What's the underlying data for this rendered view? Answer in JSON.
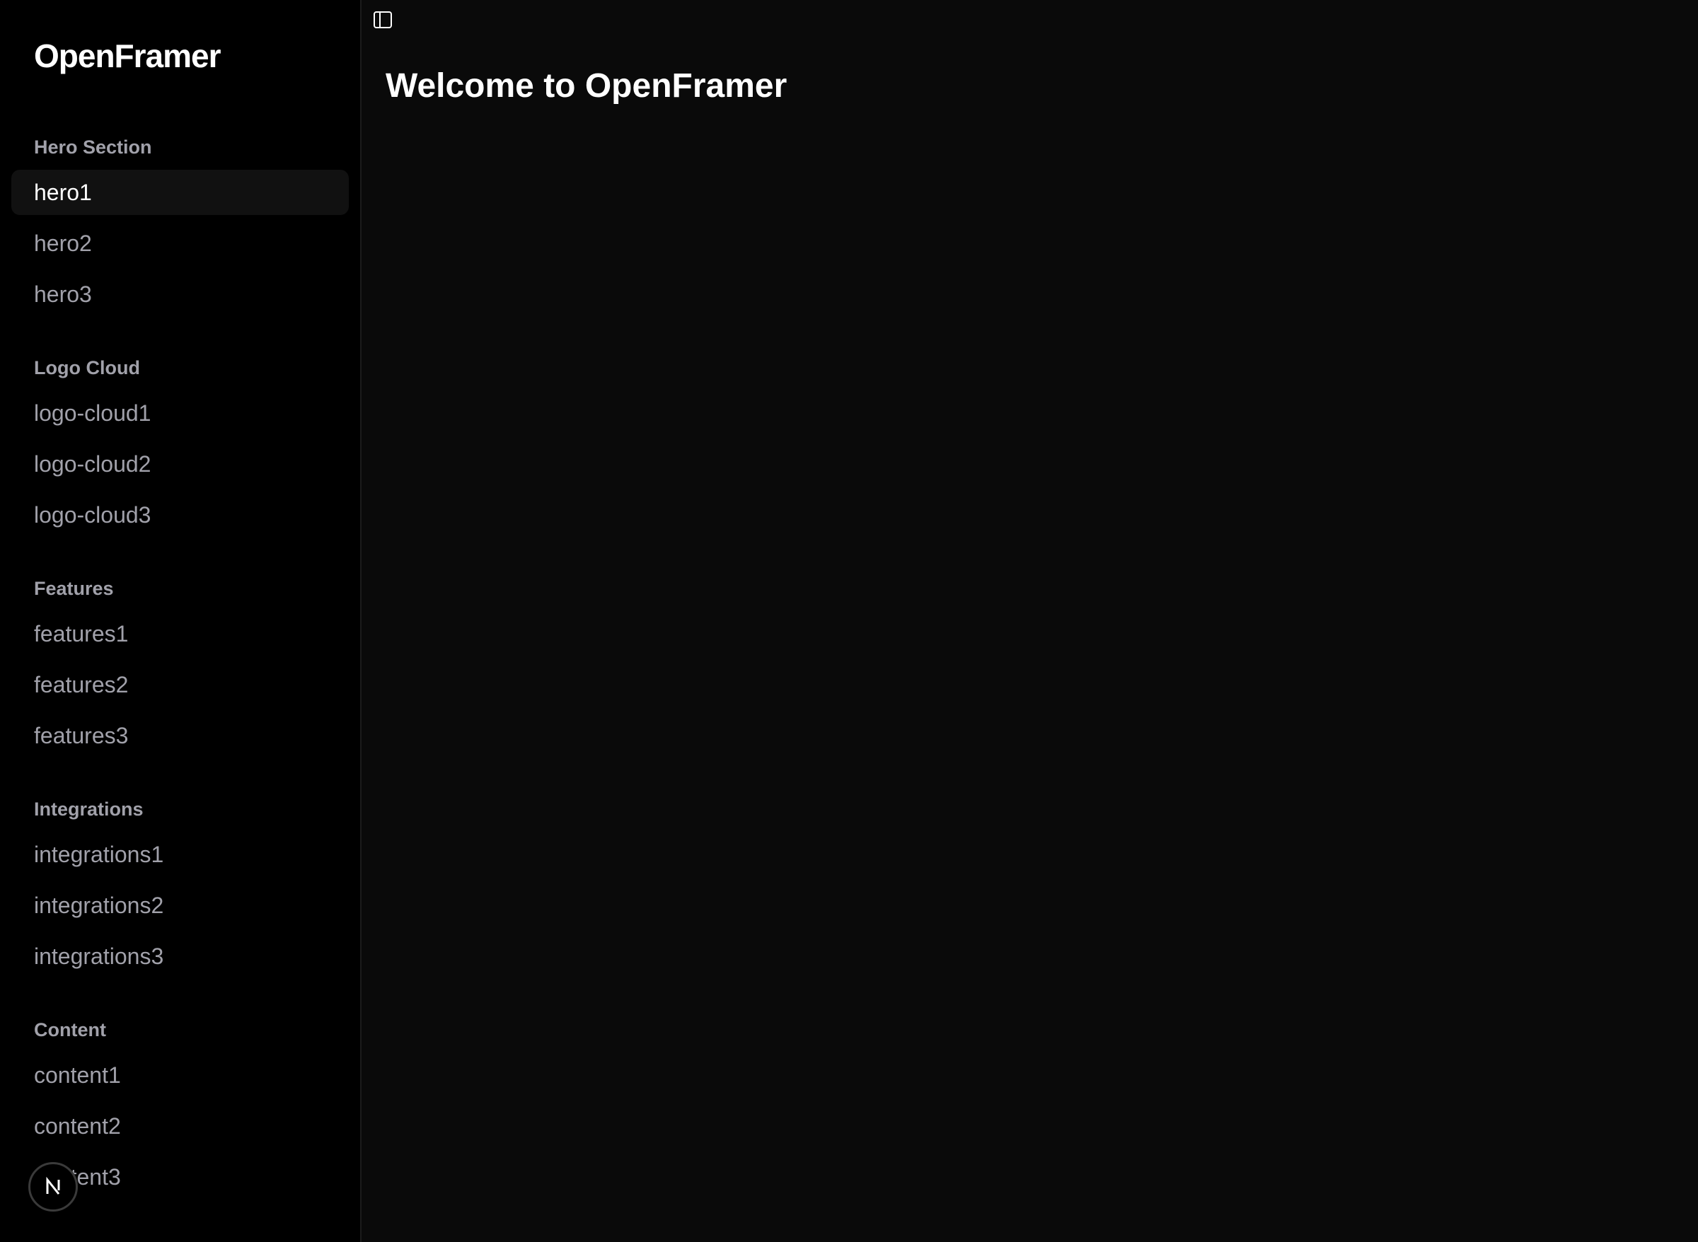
{
  "sidebar": {
    "logo": "OpenFramer",
    "groups": [
      {
        "title": "Hero Section",
        "items": [
          "hero1",
          "hero2",
          "hero3"
        ]
      },
      {
        "title": "Logo Cloud",
        "items": [
          "logo-cloud1",
          "logo-cloud2",
          "logo-cloud3"
        ]
      },
      {
        "title": "Features",
        "items": [
          "features1",
          "features2",
          "features3"
        ]
      },
      {
        "title": "Integrations",
        "items": [
          "integrations1",
          "integrations2",
          "integrations3"
        ]
      },
      {
        "title": "Content",
        "items": [
          "content1",
          "content2",
          "content3"
        ]
      }
    ],
    "active_item": "hero1"
  },
  "main": {
    "title": "Welcome to OpenFramer"
  },
  "icons": {
    "toggle": "sidebar-toggle-icon",
    "badge": "nextjs-logo-icon"
  },
  "colors": {
    "sidebar_bg": "#000000",
    "main_bg": "#0a0a0a",
    "text_primary": "#ffffff",
    "text_muted": "#a1a1aa",
    "active_bg": "#111111"
  }
}
